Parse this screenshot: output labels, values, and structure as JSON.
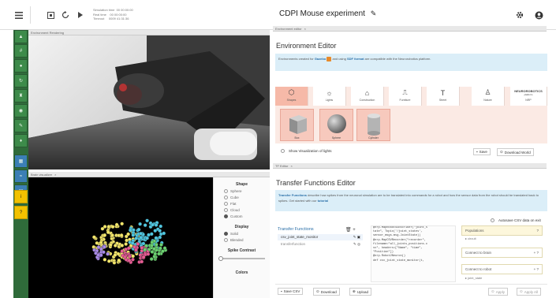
{
  "topbar": {
    "title": "CDPI Mouse experiment",
    "sim_labels": [
      "Simulation time",
      "Real time",
      "Timeout"
    ],
    "sim_values": [
      "00 00:00:00",
      "00 00:00:00",
      "0009 41:31:36"
    ]
  },
  "tabs": {
    "env_render": "Environment Rendering",
    "env_editor": "Environment editor",
    "brain_vis": "Brain visualizer",
    "tf_editor": "TF Editor"
  },
  "env_editor": {
    "title": "Environment Editor",
    "info_pre": "Environments created for ",
    "info_gazebo": "Gazebo",
    "info_mid": " and using ",
    "info_sdf": "SDF format",
    "info_post": " are compatible with the Neurorobotics platform.",
    "categories": [
      "Shapes",
      "Lights",
      "Construction",
      "Furniture",
      "Street",
      "Nature",
      "NRP"
    ],
    "nrp_logo": "NEUROROBOTICS",
    "nrp_logo_sub": "platform",
    "items": [
      "Box",
      "Sphere",
      "Cylinder"
    ],
    "show_lights": "Show Visualization of lights",
    "save": "Save",
    "download_world": "Download World"
  },
  "brain_panel": {
    "shape_header": "Shape",
    "shapes": [
      "Sphere",
      "Cube",
      "Flat",
      "Cloud",
      "Custom"
    ],
    "display_header": "Display",
    "displays": [
      "Solid",
      "Blended"
    ],
    "spike_header": "Spike Contrast",
    "colors_header": "Colors"
  },
  "tf_editor": {
    "title": "Transfer Functions Editor",
    "info_pre": "Transfer Functions",
    "info_body": " describe how spikes from the neuronal simulation are to be translated into commands for a robot and how the sensor data from the robot should be translated back to spikes. Get started with our ",
    "info_link": "tutorial",
    "autosave": "Autosave CSV data on exit",
    "list_header": "Transfer Functions",
    "functions": [
      "csv_joint_state_monitor",
      "transferfunction"
    ],
    "code": [
      "@nrp.MapRobotSubscriber(\"joint_s",
      "tate\", Topic('/joint_states',",
      " sensor_msgs.msg.JointState))",
      "@nrp.MapCSVRecorder(\"recorder\",",
      " filename=\"all_joints_positions.c",
      "sv\", headers=[\"Name\", \"time\",",
      " \"Position\"])",
      "@nrp.Robot2Neuron()",
      "def csv_joint_state_monitor(t,"
    ],
    "side_rows": [
      "Populations",
      "Connect to brain",
      "Connect to robot"
    ],
    "populations_sub": "circuit",
    "robot_sub": "joint_state",
    "buttons": [
      "Save CSV",
      "Download",
      "Upload"
    ],
    "apply": "Apply",
    "apply_all": "Apply All"
  }
}
